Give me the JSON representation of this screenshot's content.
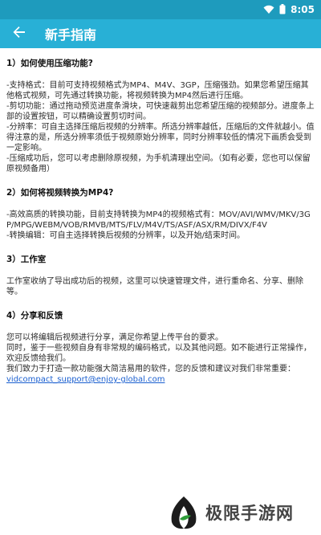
{
  "status_bar": {
    "time": "8:05",
    "icons": [
      "wifi-icon",
      "battery-icon"
    ]
  },
  "app_bar": {
    "title": "新手指南",
    "back_icon": "back-arrow-icon"
  },
  "sections": [
    {
      "title": "1）如何使用压缩功能?",
      "paragraphs": [
        "-支持格式：目前可支持视频格式为MP4、M4V、3GP，压缩强劲。如果您希望压缩其他格式视频，可先通过转换功能，将视频转换为MP4然后进行压缩。",
        "-剪切功能：通过拖动预览进度条滑块，可快速裁剪出您希望压缩的视频部分。进度条上部的设置按钮，可以精确设置剪切时间。",
        "-分辨率：可自主选择压缩后视频的分辨率。所选分辨率越低，压缩后的文件就越小。值得注意的是，所选分辨率须低于视频原始分辨率，同时分辨率较低的情况下画质会受到一定影响。",
        "-压缩成功后，您可以考虑删除原视频，为手机清理出空间。（如有必要，您也可以保留原视频备用）"
      ]
    },
    {
      "title": "2）如何将视频转换为MP4?",
      "paragraphs": [
        "-高效高质的转换功能，目前支持转换为MP4的视频格式有：MOV/AVI/WMV/MKV/3GP/MPG/WEBM/VOB/RMVB/MTS/FLV/M4V/TS/ASF/ASX/RM/DIVX/F4V",
        "-转换编辑：可自主选择转换后视频的分辨率，以及开始/结束时间。"
      ]
    },
    {
      "title": "3）工作室",
      "paragraphs": [
        "工作室收纳了导出成功后的视频，这里可以快速管理文件，进行重命名、分享、删除等。"
      ]
    },
    {
      "title": "4）分享和反馈",
      "paragraphs": [
        "您可以将编辑后视频进行分享，满足你希望上传平台的要求。",
        "同时，鉴于一些视频自身有非常规的编码格式，以及其他问题。如不能进行正常操作，欢迎反馈给我们。",
        "我们致力于打造一款功能强大简洁易用的软件，您的反馈和建议对我们非常重要："
      ],
      "email": "vidcompact_support@enjoy-global.com"
    }
  ],
  "watermark": {
    "text": "极限手游网"
  },
  "colors": {
    "status_bar": "#1e9bbd",
    "app_bar": "#28b0d6",
    "link": "#1a5fd0",
    "body_text": "#2b2b2b"
  }
}
